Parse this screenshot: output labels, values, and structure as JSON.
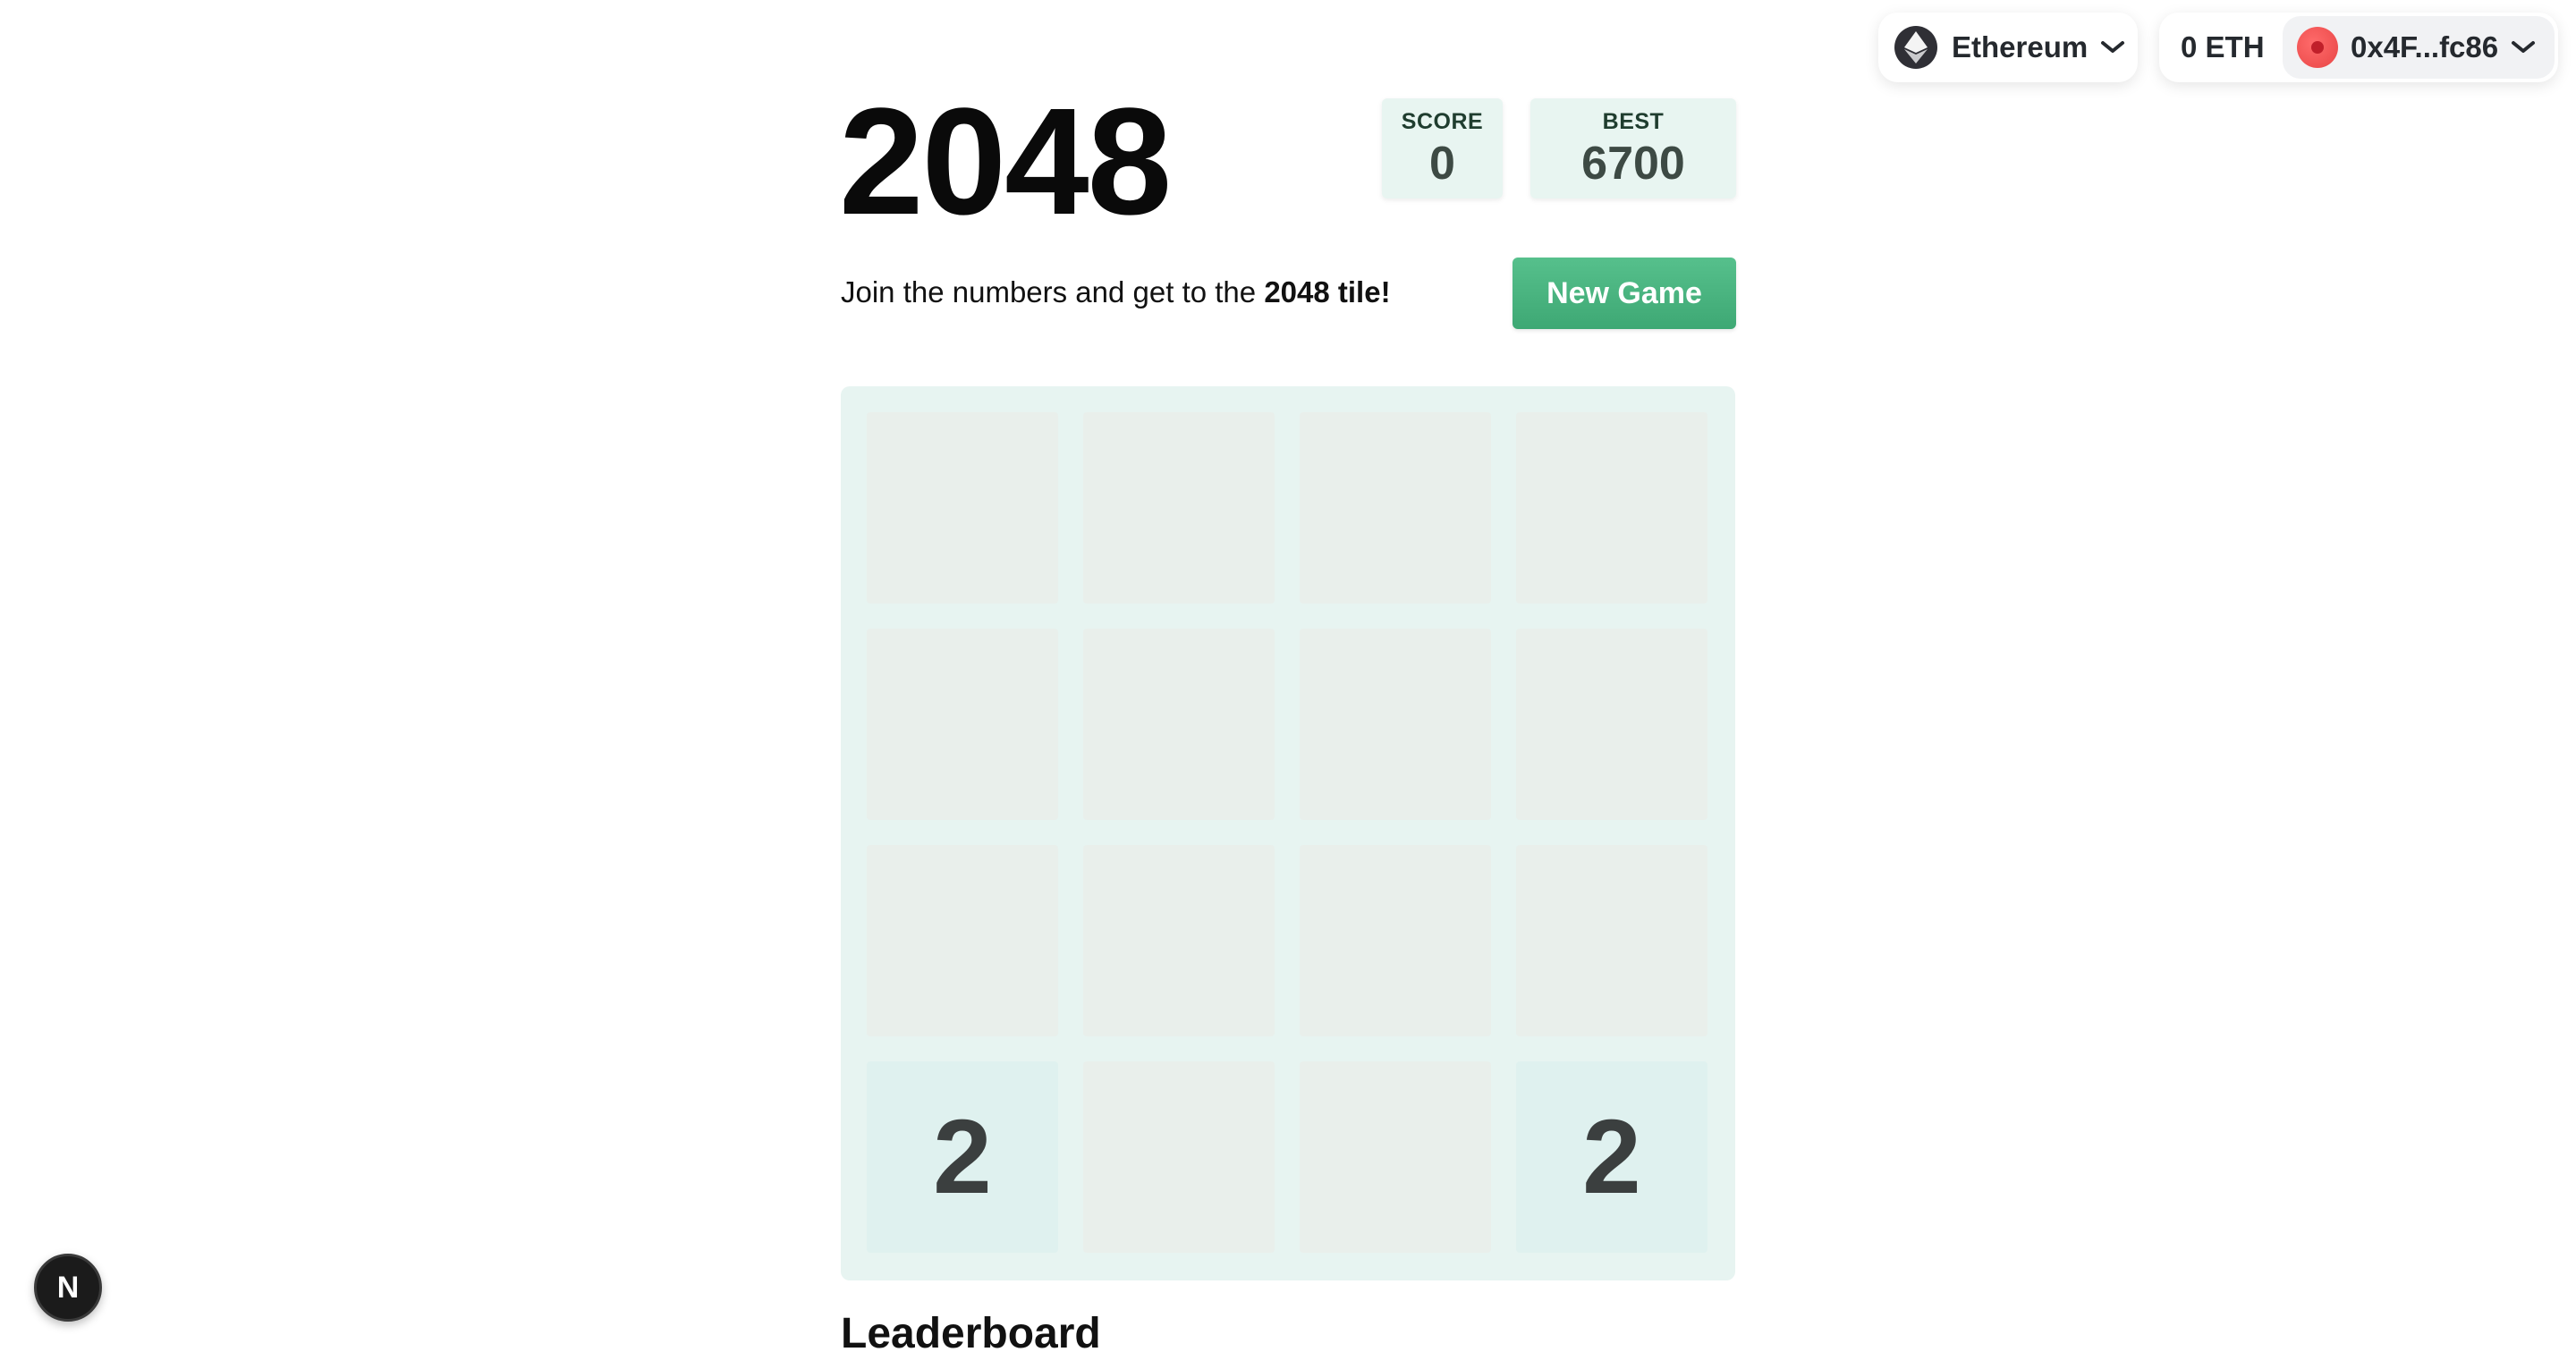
{
  "wallet": {
    "network_label": "Ethereum",
    "network_icon": "ethereum-icon",
    "balance": "0 ETH",
    "address": "0x4F...fc86"
  },
  "game": {
    "title": "2048",
    "score_label": "SCORE",
    "score_value": "0",
    "best_label": "BEST",
    "best_value": "6700",
    "intro_text": "Join the numbers and get to the ",
    "intro_bold": "2048 tile!",
    "new_game_label": "New Game",
    "board": [
      [
        "",
        "",
        "",
        ""
      ],
      [
        "",
        "",
        "",
        ""
      ],
      [
        "",
        "",
        "",
        ""
      ],
      [
        "2",
        "",
        "",
        "2"
      ]
    ]
  },
  "leaderboard": {
    "heading": "Leaderboard"
  },
  "dev_badge": {
    "label": "N"
  },
  "colors": {
    "accent_green": "#4bb47f",
    "board_bg": "#e7f4f1",
    "cell_empty": "#e9efeb",
    "tile_2": "#dff1ef"
  }
}
